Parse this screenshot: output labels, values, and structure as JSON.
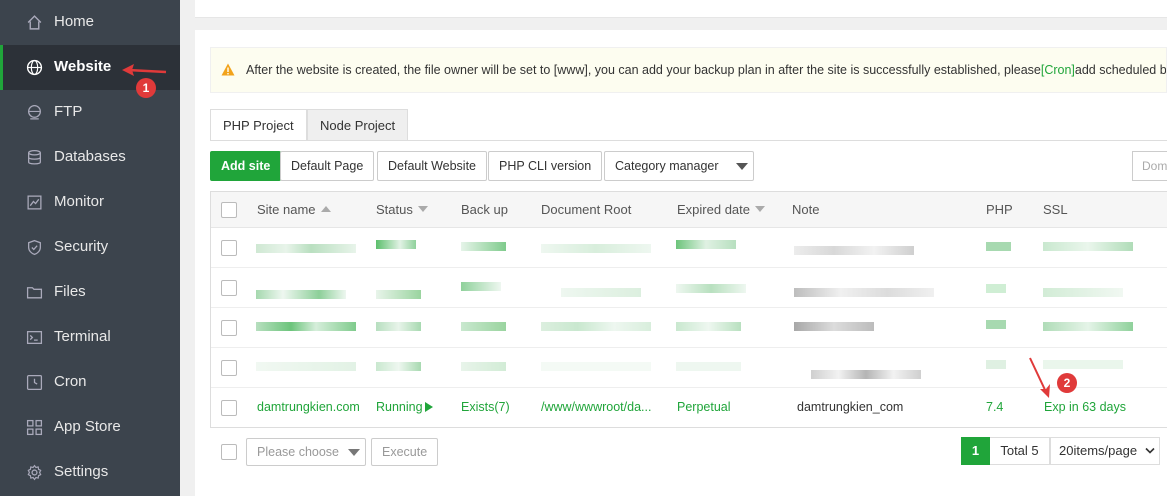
{
  "sidebar": {
    "items": [
      {
        "label": "Home",
        "icon": "home-icon"
      },
      {
        "label": "Website",
        "icon": "globe-icon",
        "active": true
      },
      {
        "label": "FTP",
        "icon": "ftp-icon"
      },
      {
        "label": "Databases",
        "icon": "database-icon"
      },
      {
        "label": "Monitor",
        "icon": "monitor-icon"
      },
      {
        "label": "Security",
        "icon": "shield-icon"
      },
      {
        "label": "Files",
        "icon": "folder-icon"
      },
      {
        "label": "Terminal",
        "icon": "terminal-icon"
      },
      {
        "label": "Cron",
        "icon": "clock-icon"
      },
      {
        "label": "App Store",
        "icon": "grid-icon"
      },
      {
        "label": "Settings",
        "icon": "gear-icon"
      }
    ]
  },
  "annotations": {
    "marker1": "1",
    "marker2": "2"
  },
  "notice": {
    "text_before": "After the website is created, the file owner will be set to [www], you can add your backup plan in after the site is successfully established, please",
    "link": "[Cron]",
    "text_after": "add scheduled backup t"
  },
  "tabs": [
    "PHP Project",
    "Node Project"
  ],
  "toolbar": {
    "add_site": "Add site",
    "default_page": "Default Page",
    "default_website": "Default Website",
    "php_cli": "PHP CLI version",
    "category_manager": "Category manager",
    "search_placeholder": "Dom"
  },
  "table": {
    "headers": [
      "Site name",
      "Status",
      "Back up",
      "Document Root",
      "Expired date",
      "Note",
      "PHP",
      "SSL"
    ],
    "visible_row": {
      "site_name": "damtrungkien.com",
      "status": "Running",
      "backup": "Exists(7)",
      "document_root": "/www/wwwroot/da...",
      "expired": "Perpetual",
      "note": "damtrungkien_com",
      "php": "7.4",
      "ssl": "Exp in 63 days"
    }
  },
  "footer": {
    "batch_placeholder": "Please choose",
    "execute": "Execute",
    "page": "1",
    "total": "Total 5",
    "per_page": "20items/page"
  },
  "colors": {
    "accent": "#20a53a",
    "sidebar": "#3c444d",
    "annotation": "#e03a3a"
  }
}
